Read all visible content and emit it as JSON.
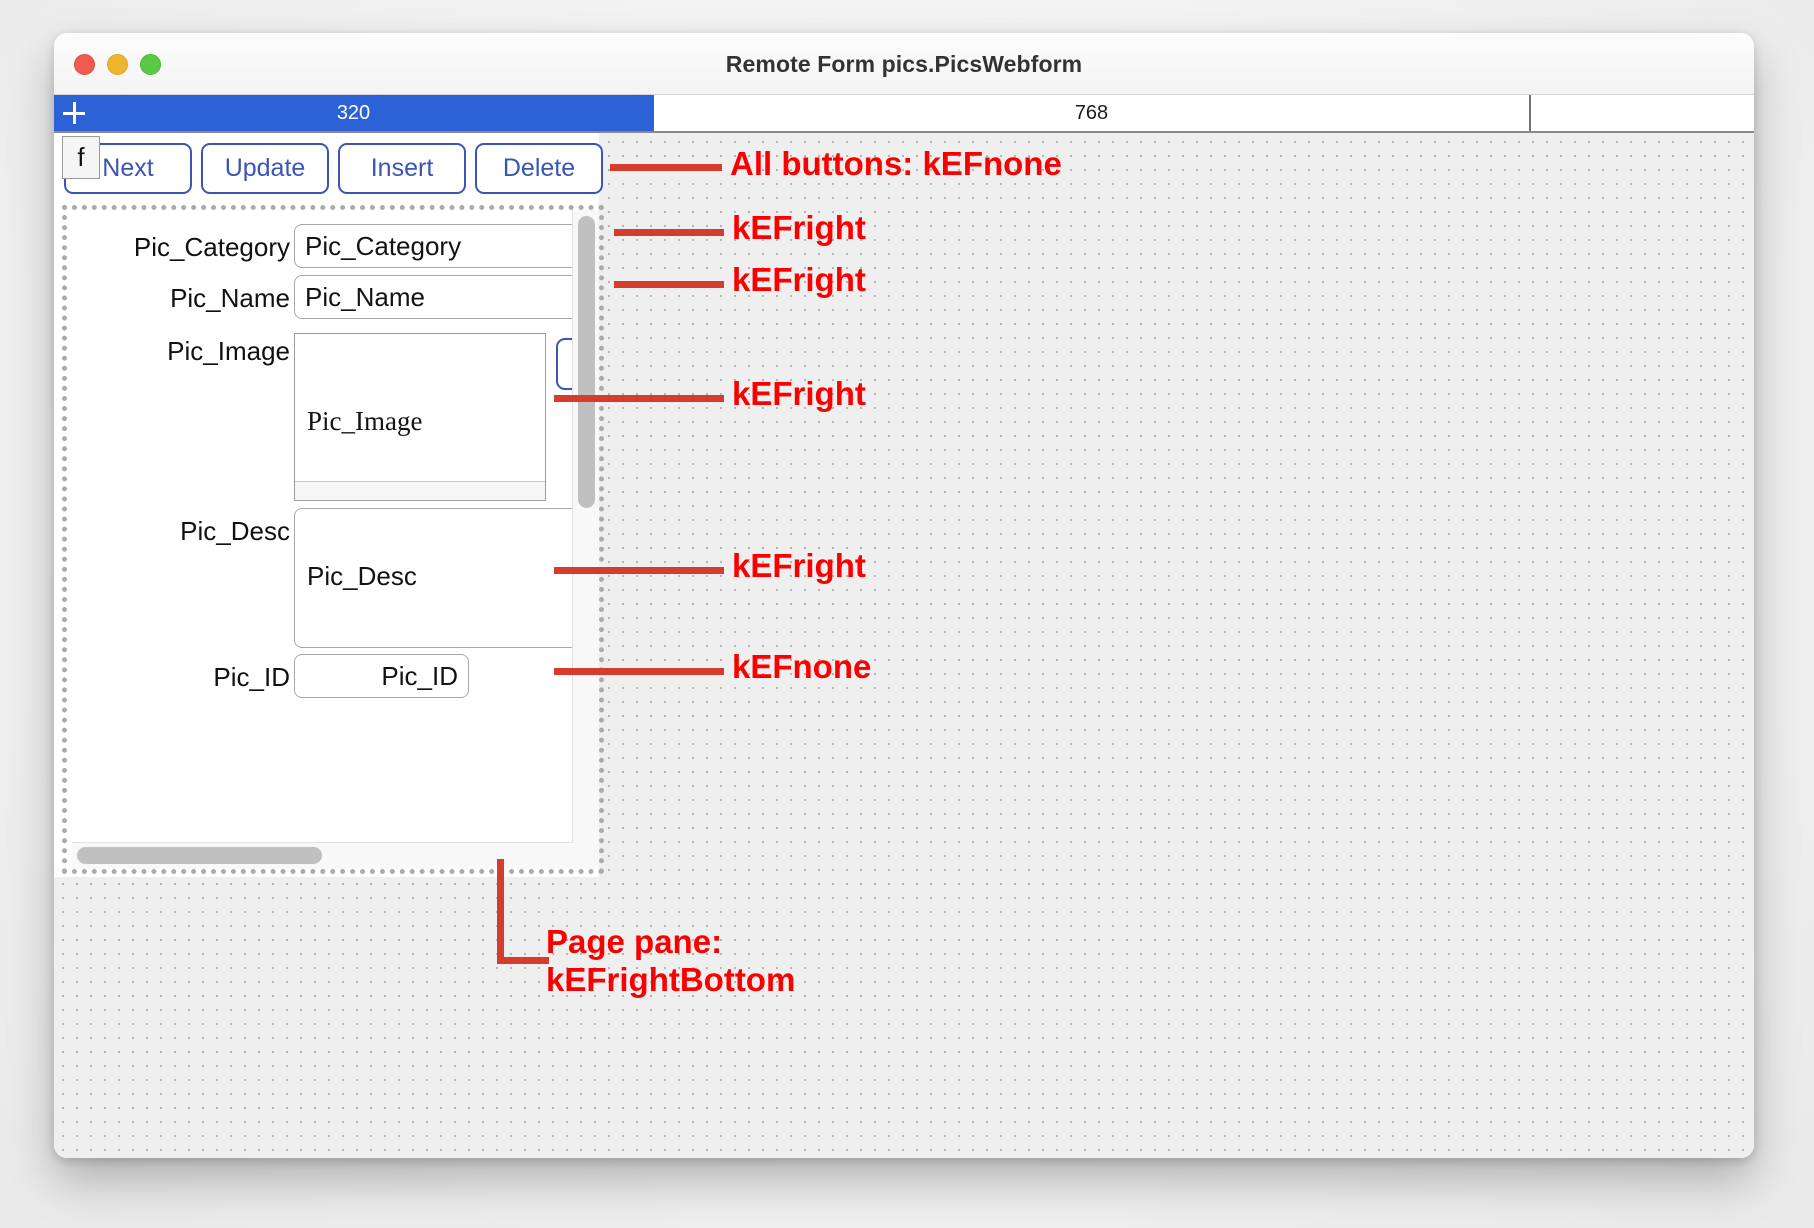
{
  "window": {
    "title": "Remote Form pics.PicsWebform",
    "traffic_lights": [
      "close",
      "minimize",
      "maximize"
    ]
  },
  "ruler": {
    "plus_icon": "plus-icon",
    "segments": [
      {
        "label": "320",
        "active": true
      },
      {
        "label": "768",
        "active": false
      },
      {
        "label": "",
        "active": false
      }
    ]
  },
  "toolbar": {
    "handle_label": "f",
    "buttons": [
      {
        "label": "Next"
      },
      {
        "label": "Update"
      },
      {
        "label": "Insert"
      },
      {
        "label": "Delete"
      }
    ]
  },
  "form": {
    "fields": [
      {
        "label": "Pic_Category",
        "value": "Pic_Category"
      },
      {
        "label": "Pic_Name",
        "value": "Pic_Name"
      },
      {
        "label": "Pic_Image",
        "value": "Pic_Image"
      },
      {
        "label": "Pic_Desc",
        "value": "Pic_Desc"
      },
      {
        "label": "Pic_ID",
        "value": "Pic_ID"
      }
    ],
    "browse_button_label": "..."
  },
  "annotations": {
    "buttons": "All buttons: kEFnone",
    "pic_category": "kEFright",
    "pic_name": "kEFright",
    "pic_image": "kEFright",
    "pic_desc": "kEFright",
    "pic_id": "kEFnone",
    "page_pane_line1": "Page pane:",
    "page_pane_line2": "kEFrightBottom"
  },
  "colors": {
    "accent_blue": "#2c62d6",
    "button_blue": "#3a55b4",
    "annotation_red": "#fa0000",
    "leader_red": "#d63c2e"
  }
}
